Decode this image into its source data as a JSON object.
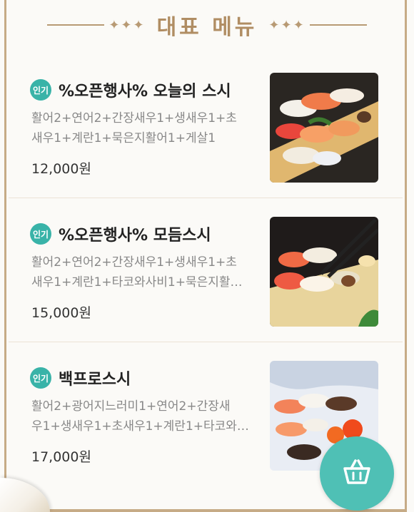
{
  "header": {
    "title": "대표 메뉴"
  },
  "menu": [
    {
      "badge": "인기",
      "name": "%오픈행사% 오늘의 스시",
      "desc_line1": "활어2+연어2+간장새우1+생새우1+초",
      "desc_line2": "새우1+계란1+묵은지활어1+게살1",
      "price": "12,000원"
    },
    {
      "badge": "인기",
      "name": "%오픈행사% 모듬스시",
      "desc_line1": "활어2+연어2+간장새우1+생새우1+초",
      "desc_line2": "새우1+계란1+타코와사비1+묵은지활…",
      "price": "15,000원"
    },
    {
      "badge": "인기",
      "name": "백프로스시",
      "desc_line1": "활어2+광어지느러미1+연어2+간장새",
      "desc_line2": "우1+생새우1+초새우1+계란1+타코와…",
      "price": "17,000원"
    }
  ],
  "colors": {
    "accent": "#39b3a8",
    "gold": "#b08d63"
  },
  "icons": {
    "cart": "shopping-basket-icon"
  }
}
